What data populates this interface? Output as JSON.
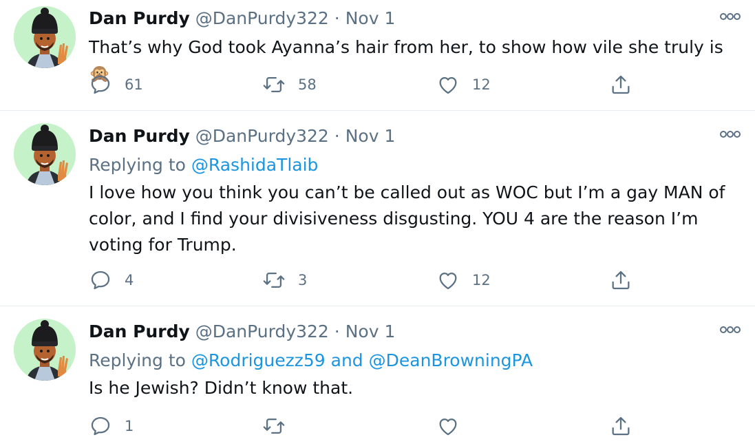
{
  "tweets": [
    {
      "name": "Dan Purdy",
      "handle": "@DanPurdy322",
      "separator": "·",
      "date": "Nov 1",
      "replying_prefix": "",
      "replying_to": "",
      "text": "That’s why God took Ayanna’s hair from her, to show how vile she truly is🙊",
      "replies": "61",
      "retweets": "58",
      "likes": "12"
    },
    {
      "name": "Dan Purdy",
      "handle": "@DanPurdy322",
      "separator": "·",
      "date": "Nov 1",
      "replying_prefix": "Replying to",
      "replying_to": "@RashidaTlaib",
      "text": "I love how you think you can’t be called out as WOC but I’m a gay MAN of color, and I find your divisiveness disgusting. YOU 4 are the reason I’m voting for Trump.",
      "replies": "4",
      "retweets": "3",
      "likes": "12"
    },
    {
      "name": "Dan Purdy",
      "handle": "@DanPurdy322",
      "separator": "·",
      "date": "Nov 1",
      "replying_prefix": "Replying to",
      "replying_to": "@Rodriguezz59 and @DeanBrowningPA",
      "text": "Is he Jewish? Didn’t know that.",
      "replies": "1",
      "retweets": "",
      "likes": ""
    }
  ],
  "icons": {
    "avatar": "memoji-avatar",
    "more": "more-options-icon",
    "reply": "reply-icon",
    "retweet": "retweet-icon",
    "like": "like-icon",
    "share": "share-icon"
  },
  "colors": {
    "text": "#0f1419",
    "secondary": "#5b7083",
    "link": "#1b95e0",
    "avatar_bg": "#c6f2c9",
    "divider": "#e6ecf0"
  }
}
